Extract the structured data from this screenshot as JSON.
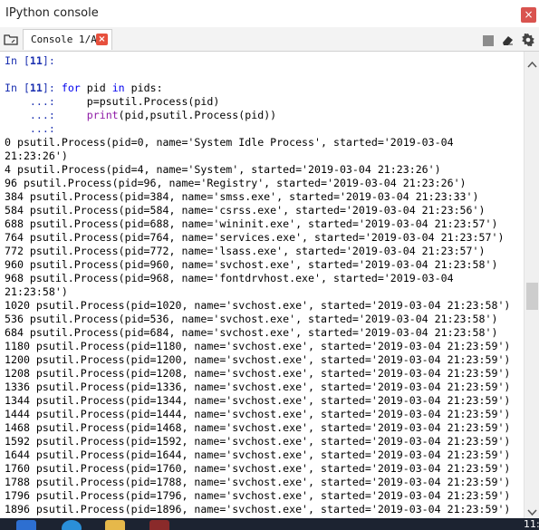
{
  "window": {
    "title": "IPython console",
    "close_glyph": "×"
  },
  "tab": {
    "label": "Console 1/A",
    "close_glyph": "×"
  },
  "console": {
    "lines": [
      "In [11]:",
      "",
      "In [11]: for pid in pids:",
      "    ...:     p=psutil.Process(pid)",
      "    ...:     print(pid,psutil.Process(pid))",
      "    ...: ",
      "0 psutil.Process(pid=0, name='System Idle Process', started='2019-03-04",
      "21:23:26')",
      "4 psutil.Process(pid=4, name='System', started='2019-03-04 21:23:26')",
      "96 psutil.Process(pid=96, name='Registry', started='2019-03-04 21:23:26')",
      "384 psutil.Process(pid=384, name='smss.exe', started='2019-03-04 21:23:33')",
      "584 psutil.Process(pid=584, name='csrss.exe', started='2019-03-04 21:23:56')",
      "688 psutil.Process(pid=688, name='wininit.exe', started='2019-03-04 21:23:57')",
      "764 psutil.Process(pid=764, name='services.exe', started='2019-03-04 21:23:57')",
      "772 psutil.Process(pid=772, name='lsass.exe', started='2019-03-04 21:23:57')",
      "960 psutil.Process(pid=960, name='svchost.exe', started='2019-03-04 21:23:58')",
      "968 psutil.Process(pid=968, name='fontdrvhost.exe', started='2019-03-04",
      "21:23:58')",
      "1020 psutil.Process(pid=1020, name='svchost.exe', started='2019-03-04 21:23:58')",
      "536 psutil.Process(pid=536, name='svchost.exe', started='2019-03-04 21:23:58')",
      "684 psutil.Process(pid=684, name='svchost.exe', started='2019-03-04 21:23:58')",
      "1180 psutil.Process(pid=1180, name='svchost.exe', started='2019-03-04 21:23:59')",
      "1200 psutil.Process(pid=1200, name='svchost.exe', started='2019-03-04 21:23:59')",
      "1208 psutil.Process(pid=1208, name='svchost.exe', started='2019-03-04 21:23:59')",
      "1336 psutil.Process(pid=1336, name='svchost.exe', started='2019-03-04 21:23:59')",
      "1344 psutil.Process(pid=1344, name='svchost.exe', started='2019-03-04 21:23:59')",
      "1444 psutil.Process(pid=1444, name='svchost.exe', started='2019-03-04 21:23:59')",
      "1468 psutil.Process(pid=1468, name='svchost.exe', started='2019-03-04 21:23:59')",
      "1592 psutil.Process(pid=1592, name='svchost.exe', started='2019-03-04 21:23:59')",
      "1644 psutil.Process(pid=1644, name='svchost.exe', started='2019-03-04 21:23:59')",
      "1760 psutil.Process(pid=1760, name='svchost.exe', started='2019-03-04 21:23:59')",
      "1788 psutil.Process(pid=1788, name='svchost.exe', started='2019-03-04 21:23:59')",
      "1796 psutil.Process(pid=1796, name='svchost.exe', started='2019-03-04 21:23:59')",
      "1896 psutil.Process(pid=1896, name='svchost.exe', started='2019-03-04 21:23:59')"
    ]
  },
  "toolbar": {
    "icons": [
      "stop-icon",
      "eraser-icon",
      "options-menu-icon"
    ]
  },
  "taskbar": {
    "clock_fragment": "11:"
  },
  "colors": {
    "prompt": "#1a2fb0",
    "keyword": "#0000ee",
    "builtin": "#8e1aa6",
    "tab_close": "#e7503d",
    "window_close": "#d9534f"
  }
}
